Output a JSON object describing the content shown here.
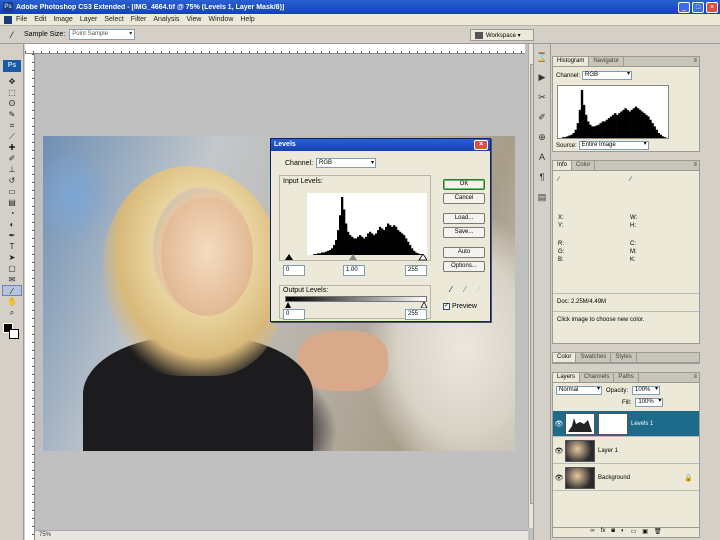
{
  "window": {
    "title": "Adobe Photoshop CS3 Extended - [IMG_4664.tif @ 75% (Levels 1, Layer Mask/8)]",
    "app_icon": "Ps",
    "min": "_",
    "max": "□",
    "close": "×"
  },
  "menu": [
    "File",
    "Edit",
    "Image",
    "Layer",
    "Select",
    "Filter",
    "Analysis",
    "View",
    "Window",
    "Help"
  ],
  "options": {
    "sample_label": "Sample Size:",
    "sample_value": "Point Sample",
    "workspace_label": "Workspace ▾"
  },
  "toolbox": {
    "logo": "Ps",
    "tools": [
      {
        "name": "move-tool-icon",
        "glyph": "✥"
      },
      {
        "name": "marquee-tool-icon",
        "glyph": "⬚"
      },
      {
        "name": "lasso-tool-icon",
        "glyph": "ʘ"
      },
      {
        "name": "quick-select-tool-icon",
        "glyph": "✎"
      },
      {
        "name": "crop-tool-icon",
        "glyph": "⌗"
      },
      {
        "name": "slice-tool-icon",
        "glyph": "⟋"
      },
      {
        "name": "healing-tool-icon",
        "glyph": "✚"
      },
      {
        "name": "brush-tool-icon",
        "glyph": "✐"
      },
      {
        "name": "stamp-tool-icon",
        "glyph": "⊥"
      },
      {
        "name": "history-brush-icon",
        "glyph": "↺"
      },
      {
        "name": "eraser-tool-icon",
        "glyph": "▭"
      },
      {
        "name": "gradient-tool-icon",
        "glyph": "▤"
      },
      {
        "name": "blur-tool-icon",
        "glyph": "◔"
      },
      {
        "name": "dodge-tool-icon",
        "glyph": "◐"
      },
      {
        "name": "pen-tool-icon",
        "glyph": "✒"
      },
      {
        "name": "type-tool-icon",
        "glyph": "T"
      },
      {
        "name": "path-select-tool-icon",
        "glyph": "➤"
      },
      {
        "name": "shape-tool-icon",
        "glyph": "▢"
      },
      {
        "name": "notes-tool-icon",
        "glyph": "✉"
      },
      {
        "name": "eyedropper-tool-icon",
        "glyph": "⁄"
      },
      {
        "name": "hand-tool-icon",
        "glyph": "✋"
      },
      {
        "name": "zoom-tool-icon",
        "glyph": "⌕"
      }
    ]
  },
  "status": "75%",
  "levels": {
    "title": "Levels",
    "channel_label": "Channel:",
    "channel_value": "RGB",
    "input_label": "Input Levels:",
    "input_black": "0",
    "input_gamma": "1.00",
    "input_white": "255",
    "output_label": "Output Levels:",
    "output_black": "0",
    "output_white": "255",
    "buttons": [
      "OK",
      "Cancel",
      "Load...",
      "Save...",
      "Auto",
      "Options..."
    ],
    "preview_label": "Preview",
    "histogram": [
      0,
      0,
      0,
      1,
      1,
      2,
      2,
      3,
      3,
      4,
      5,
      6,
      8,
      12,
      18,
      30,
      48,
      70,
      55,
      38,
      28,
      24,
      22,
      20,
      20,
      22,
      24,
      22,
      20,
      22,
      26,
      28,
      26,
      24,
      26,
      30,
      34,
      32,
      30,
      34,
      38,
      36,
      34,
      36,
      34,
      30,
      28,
      26,
      24,
      20,
      16,
      12,
      8,
      5,
      3,
      2,
      1,
      1,
      0,
      0
    ]
  },
  "navigator": {
    "tabs": [
      "Histogram",
      "Navigator"
    ],
    "channel_label": "Channel:",
    "channel_value": "RGB",
    "source_label": "Source:",
    "source_value": "Entire Image",
    "histogram": [
      0,
      0,
      1,
      1,
      2,
      3,
      4,
      6,
      10,
      18,
      34,
      58,
      40,
      28,
      20,
      16,
      14,
      14,
      15,
      16,
      18,
      20,
      20,
      22,
      24,
      26,
      28,
      30,
      28,
      30,
      32,
      34,
      36,
      34,
      32,
      34,
      36,
      38,
      36,
      34,
      32,
      30,
      28,
      26,
      22,
      18,
      14,
      10,
      6,
      4,
      2,
      1,
      0
    ]
  },
  "info": {
    "tabs": [
      "Info",
      "Color"
    ],
    "labels": [
      "R:",
      "G:",
      "B:",
      "C:",
      "M:",
      "Y:",
      "K:",
      "X:",
      "Y:",
      "W:",
      "H:"
    ],
    "vals_left": [
      "",
      "",
      "",
      "",
      "",
      "",
      "",
      "",
      "",
      "",
      ""
    ],
    "doc_line": "Doc: 2.25M/4.49M",
    "hint": "Click image to choose new color."
  },
  "styles_tabs": [
    "Color",
    "Swatches",
    "Styles"
  ],
  "layers": {
    "tabs": [
      "Layers",
      "Channels",
      "Paths"
    ],
    "blend_mode": "Normal",
    "opacity_label": "Opacity:",
    "opacity_value": "100%",
    "fill_label": "Fill:",
    "fill_value": "100%",
    "rows": [
      {
        "name": "Levels 1",
        "type": "adjustment",
        "selected": true
      },
      {
        "name": "Layer 1",
        "type": "photo",
        "selected": false
      },
      {
        "name": "Background",
        "type": "photo",
        "selected": false
      }
    ],
    "bottom_icons": [
      "∞",
      "fx",
      "◙",
      "◐",
      "▭",
      "▣",
      "🗑"
    ]
  },
  "colors": {
    "title_bar": "#1542b0",
    "layer_selected": "#1d6a8a"
  }
}
